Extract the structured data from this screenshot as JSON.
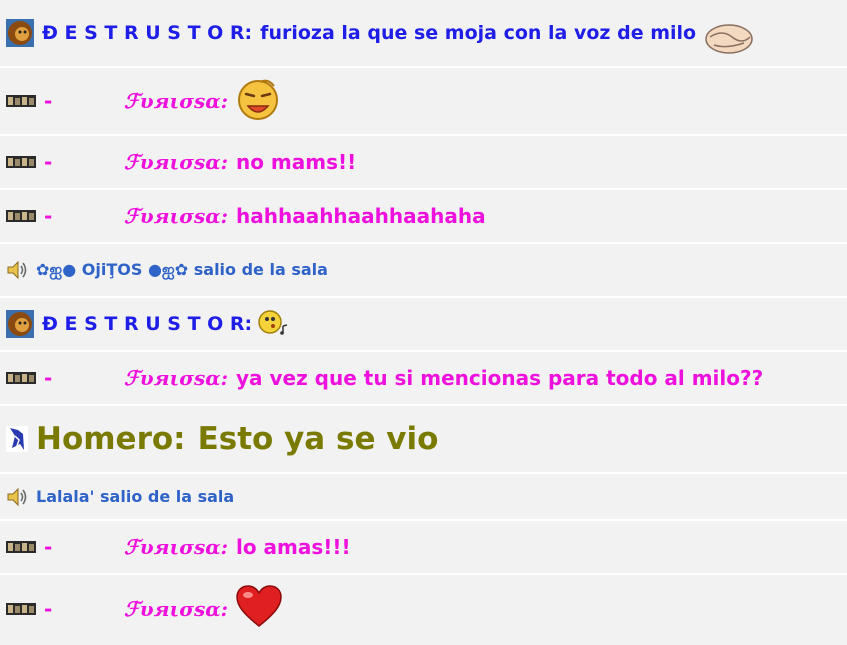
{
  "rows": [
    {
      "user": "Đ E S T R U S T O R:",
      "text": "furioza la que se moja con la voz de milo",
      "icon": "handshake-emoticon"
    },
    {
      "dash": "-",
      "user": "ℱυяισѕα:",
      "text": "",
      "icon": "laughing-emoticon"
    },
    {
      "dash": "-",
      "user": "ℱυяισѕα:",
      "text": "no mams!!"
    },
    {
      "dash": "-",
      "user": "ℱυяισѕα:",
      "text": "hahhaahhaahhaahaha"
    },
    {
      "text": "✿ஐ● OjiŢOS ●ஐ✿ salio de la sala",
      "icon": "speaker-icon"
    },
    {
      "user": "Đ E S T R U S T O R:",
      "text": "",
      "icon": "whistling-emoticon"
    },
    {
      "dash": "-",
      "user": "ℱυяισѕα:",
      "text": "ya vez que tu si mencionas para todo al milo??"
    },
    {
      "user": "Homero:",
      "text": "Esto ya se vio"
    },
    {
      "text": "Lalala' salio de la sala",
      "icon": "speaker-icon"
    },
    {
      "dash": "-",
      "user": "ℱυяισѕα:",
      "text": "lo amas!!!"
    },
    {
      "dash": "-",
      "user": "ℱυяισѕα:",
      "text": "",
      "icon": "heart-emoticon"
    }
  ],
  "colors": {
    "background": "#f2f2f2",
    "separator": "#ffffff",
    "destrustor": "#1e1ee8",
    "furiosa": "#ee11dd",
    "system": "#2f63c8",
    "homero": "#7a7a00"
  }
}
